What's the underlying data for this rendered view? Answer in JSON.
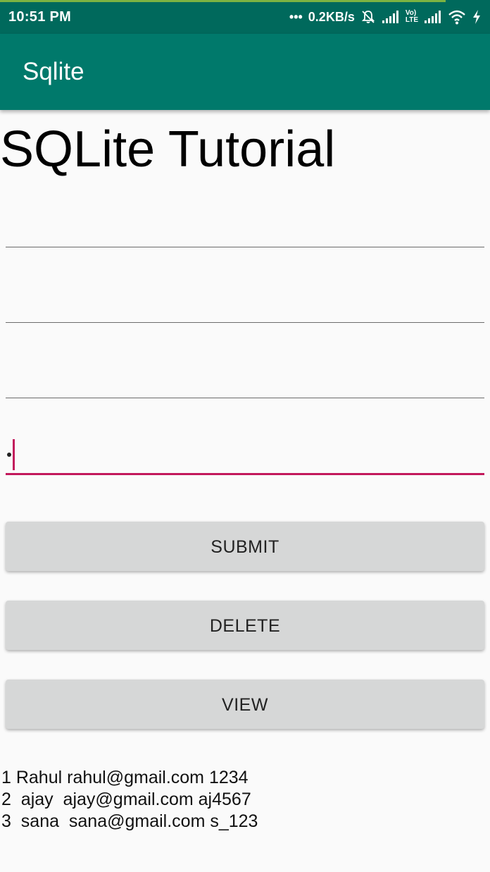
{
  "status_bar": {
    "time": "10:51 PM",
    "dots": "•••",
    "net_speed": "0.2KB/s",
    "volte_label_top": "Vo)",
    "volte_label_bottom": "LTE",
    "download_progress": 0.91,
    "colors": {
      "background": "#00695c",
      "progress": "#7cb342"
    }
  },
  "toolbar": {
    "title": "Sqlite",
    "color": "#00796b"
  },
  "main": {
    "heading": "SQLite Tutorial",
    "fields": [
      {
        "value": "",
        "placeholder": ""
      },
      {
        "value": "",
        "placeholder": ""
      },
      {
        "value": "",
        "placeholder": ""
      },
      {
        "value": "",
        "placeholder": ""
      }
    ],
    "accent_color": "#c2185b",
    "buttons": {
      "submit": "SUBMIT",
      "delete": "DELETE",
      "view": "VIEW"
    },
    "results": [
      "1 Rahul rahul@gmail.com 1234",
      "2  ajay  ajay@gmail.com aj4567",
      "3  sana  sana@gmail.com s_123"
    ]
  }
}
